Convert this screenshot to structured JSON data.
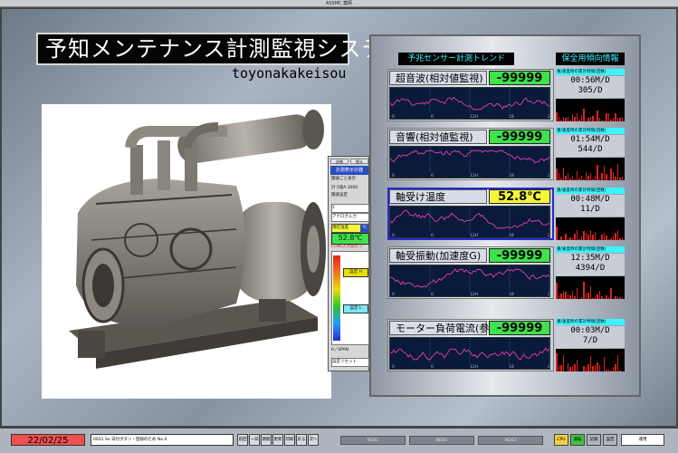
{
  "window": {
    "caption": "ASSMC 薬師"
  },
  "header": {
    "title": "予知メンテナンス計測監視システム",
    "subtitle": "toyonakakeisou"
  },
  "panel": {
    "trend_header": "予兆センサー計測トレンド",
    "maint_header": "保全用傾向情報"
  },
  "sensors": [
    {
      "name": "超音波(相対値監視)",
      "value": "-99999",
      "value_color": "#3ee24a",
      "maint_label": "重/速度時の累計時間(回数)",
      "time": "00:56M/D",
      "count": "305/D",
      "ticks": [
        "0",
        "6",
        "12H",
        "18",
        "24"
      ]
    },
    {
      "name": "音響(相対値監視)",
      "value": "-99999",
      "value_color": "#3ee24a",
      "maint_label": "重/速度時の累計時間(回数)",
      "time": "01:54M/D",
      "count": "544/D",
      "ticks": [
        "0",
        "6",
        "12H",
        "18",
        "24"
      ]
    },
    {
      "name": "軸受け温度",
      "value": "52.8℃",
      "value_color": "#f5f53a",
      "maint_label": "重/速度時の累計時間(回数)",
      "time": "00:48M/D",
      "count": "11/D",
      "ticks": [
        "0",
        "6",
        "12H",
        "18",
        "24"
      ]
    },
    {
      "name": "軸受振動(加速度G)",
      "value": "-99999",
      "value_color": "#3ee24a",
      "maint_label": "重/速度時の累計時間(回数)",
      "time": "12:35M/D",
      "count": "4394/D",
      "ticks": [
        "0",
        "6",
        "12H",
        "18",
        "24"
      ]
    },
    {
      "name": "モーター負荷電流(参",
      "value": "-99999",
      "value_color": "#3ee24a",
      "maint_label": "重/速度時の累計時間(回数)",
      "time": "00:03M/D",
      "count": "7/D",
      "ticks": [
        "0",
        "6",
        "12H",
        "18",
        "24"
      ]
    }
  ],
  "strip": {
    "tabs": [
      "詳細",
      "閉る"
    ],
    "title": "計測表示計器",
    "sub": "閾値ごと表示",
    "opt1": "計 5値A 3000",
    "opt2": "閾値設定",
    "select1": "1",
    "select2": "アナログ入力",
    "label_temp": "現在温度",
    "unit": "℃",
    "value": "52.8℃",
    "status": "COM/入力値エラ-",
    "set_h": "設定 H",
    "set_l": "設定 L",
    "zero_span": "0 / SPAN",
    "reset": "設定リセット"
  },
  "bottom": {
    "date": "22/02/25",
    "info": "0031 Se 日付ボタン・登録のため No.4",
    "buttons": [
      "前回",
      "一日",
      "期間",
      "更新",
      "印刷",
      "戻る",
      "次へ"
    ],
    "status_fields": [
      "ND01",
      "ND02",
      "ND03"
    ],
    "flags": [
      "CPU",
      "運転",
      "記録",
      "設定"
    ],
    "flag_colors": [
      "#f0d040",
      "#40c040",
      "#aeb5bf",
      "#aeb5bf"
    ],
    "mode": "運用"
  }
}
